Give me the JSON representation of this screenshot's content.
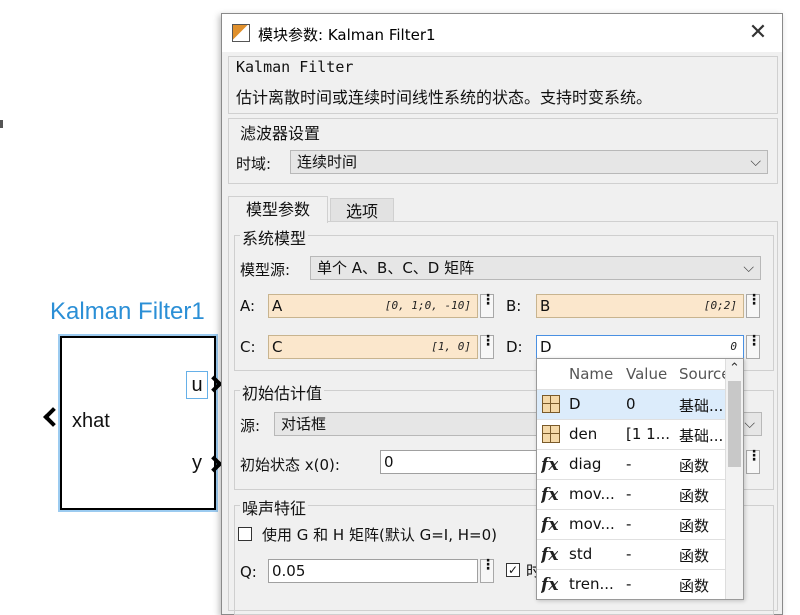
{
  "canvas": {
    "block_title": "Kalman Filter1",
    "input_label": "xhat",
    "output_u": "u",
    "output_y": "y"
  },
  "dialog": {
    "title": "模块参数: Kalman Filter1",
    "close_label": "✕",
    "desc_title": "Kalman Filter",
    "desc_text": "估计离散时间或连续时间线性系统的状态。支持时变系统。",
    "filter_group": "滤波器设置",
    "time_domain_label": "时域:",
    "time_domain_value": "连续时间",
    "tabs": [
      {
        "label": "模型参数",
        "active": true
      },
      {
        "label": "选项",
        "active": false
      }
    ],
    "system_model": {
      "legend": "系统模型",
      "source_label": "模型源:",
      "source_value": "单个 A、B、C、D 矩阵",
      "A_label": "A:",
      "A_value": "A",
      "A_hint": "[0, 1;0, -10]",
      "B_label": "B:",
      "B_value": "B",
      "B_hint": "[0;2]",
      "C_label": "C:",
      "C_value": "C",
      "C_hint": "[1, 0]",
      "D_label": "D:",
      "D_value": "D",
      "D_hint": "0"
    },
    "initial_estimate": {
      "legend": "初始估计值",
      "source_label": "源:",
      "source_value": "对话框",
      "x0_label": "初始状态 x(0):",
      "x0_value": "0"
    },
    "noise": {
      "legend": "噪声特征",
      "use_gh_label": "使用 G 和 H 矩阵(默认 G=I, H=0)",
      "q_label": "Q:",
      "q_value": "0.05",
      "q_checkbox_label": "时"
    }
  },
  "autocomplete": {
    "columns": [
      "Name",
      "Value",
      "Source"
    ],
    "rows": [
      {
        "icon": "matrix-icon",
        "name": "D",
        "value": "0",
        "source": "基础..."
      },
      {
        "icon": "matrix-icon",
        "name": "den",
        "value": "[1 1...",
        "source": "基础..."
      },
      {
        "icon": "function-icon",
        "name": "diag",
        "value": "-",
        "source": "函数"
      },
      {
        "icon": "function-icon",
        "name": "mov...",
        "value": "-",
        "source": "函数"
      },
      {
        "icon": "function-icon",
        "name": "mov...",
        "value": "-",
        "source": "函数"
      },
      {
        "icon": "function-icon",
        "name": "std",
        "value": "-",
        "source": "函数"
      },
      {
        "icon": "function-icon",
        "name": "tren...",
        "value": "-",
        "source": "函数"
      }
    ],
    "fx_glyph": "fx"
  },
  "colors": {
    "block_title": "#2b8fd6",
    "field_fill": "#fbe7cc",
    "selection": "#dcecfb"
  }
}
